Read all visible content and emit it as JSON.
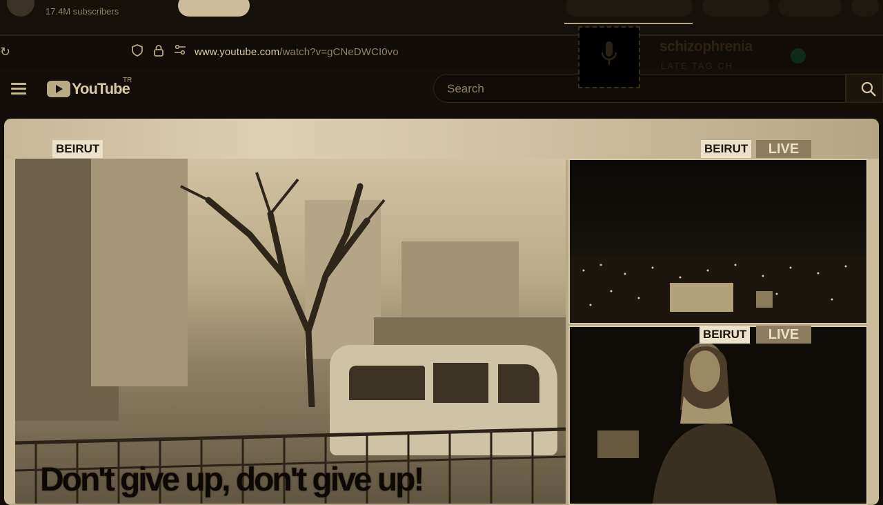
{
  "previous_page": {
    "subscribers": "17.4M subscribers"
  },
  "browser": {
    "url_host": "www.youtube.com",
    "url_path": "/watch?v=gCNeDWCI0vo"
  },
  "youtube": {
    "logo_text": "YouTube",
    "country_code": "TR",
    "search_placeholder": "Search"
  },
  "notification": {
    "title": "schizophrenia",
    "subtitle": "LATE TAG CH"
  },
  "video": {
    "main_location": "BEIRUT",
    "cam1_location": "BEIRUT",
    "cam1_status": "LIVE",
    "cam2_location": "BEIRUT",
    "cam2_status": "LIVE",
    "subtitle": "Don't give up, don't give up!"
  },
  "colors": {
    "background": "#120d07",
    "accent": "#d8c9a6",
    "live_badge": "#8c7d5f"
  }
}
